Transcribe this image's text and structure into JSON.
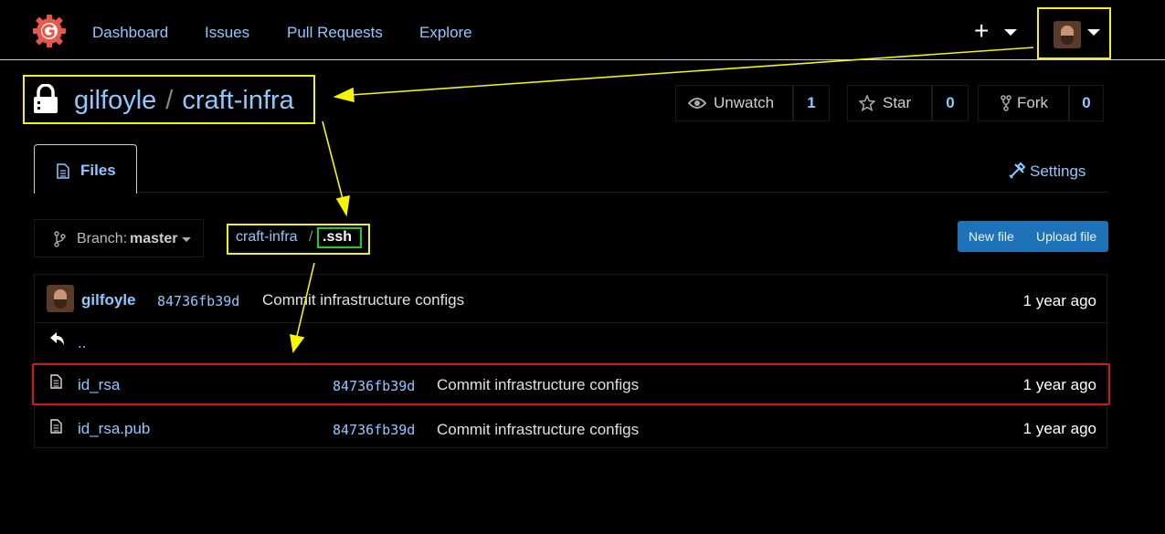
{
  "header": {
    "nav": [
      "Dashboard",
      "Issues",
      "Pull Requests",
      "Explore"
    ],
    "plus_label": "+"
  },
  "repo": {
    "owner": "gilfoyle",
    "separator": "/",
    "name": "craft-infra"
  },
  "actions": {
    "watch_label": "Unwatch",
    "watch_count": "1",
    "star_label": "Star",
    "star_count": "0",
    "fork_label": "Fork",
    "fork_count": "0"
  },
  "tabs": {
    "files_label": "Files",
    "settings_label": "Settings"
  },
  "branch": {
    "prefix": "Branch:",
    "name": "master"
  },
  "breadcrumb": {
    "parent": "craft-infra",
    "separator": "/",
    "current": ".ssh"
  },
  "file_buttons": {
    "new_file": "New file",
    "upload_file": "Upload file"
  },
  "latest_commit": {
    "author": "gilfoyle",
    "sha": "84736fb39d",
    "message": "Commit infrastructure configs",
    "age": "1 year ago"
  },
  "parent_dir": "..",
  "files": [
    {
      "name": "id_rsa",
      "sha": "84736fb39d",
      "message": "Commit infrastructure configs",
      "age": "1 year ago"
    },
    {
      "name": "id_rsa.pub",
      "sha": "84736fb39d",
      "message": "Commit infrastructure configs",
      "age": "1 year ago"
    }
  ],
  "colors": {
    "annotation_yellow": "#f5f500",
    "annotation_green": "#22cc22",
    "annotation_red": "#cc1a1a",
    "link": "#8fc7ff",
    "primary_button": "#1e72b8",
    "logo": "#e8584a"
  },
  "icons": [
    "gitea-logo-icon",
    "plus-icon",
    "chevron-down-icon",
    "lock-icon",
    "eye-icon",
    "star-icon",
    "fork-icon",
    "file-text-icon",
    "tools-icon",
    "branch-icon",
    "reply-arrow-icon"
  ]
}
